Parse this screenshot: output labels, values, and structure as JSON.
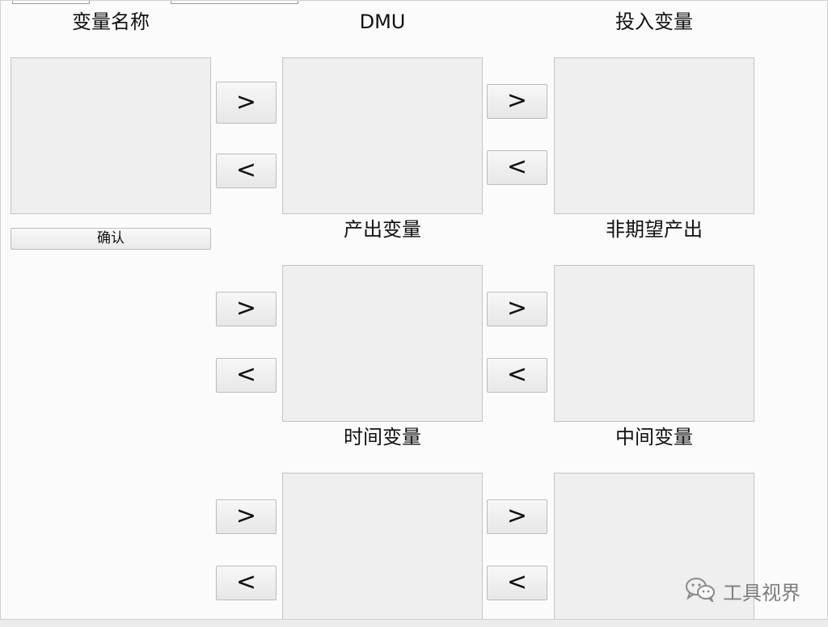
{
  "labels": {
    "variable_names": "变量名称",
    "dmu": "DMU",
    "input_vars": "投入变量",
    "output_vars": "产出变量",
    "undesired_outputs": "非期望产出",
    "time_vars": "时间变量",
    "intermediate_vars": "中间变量"
  },
  "buttons": {
    "add": ">",
    "remove": "<",
    "confirm": "确认"
  },
  "watermark": {
    "text": "工具视界",
    "icon": "wechat-icon"
  },
  "colors": {
    "listbox_bg": "#efefef",
    "window_bg": "#fbfbfb",
    "border": "#c4c4c4"
  }
}
